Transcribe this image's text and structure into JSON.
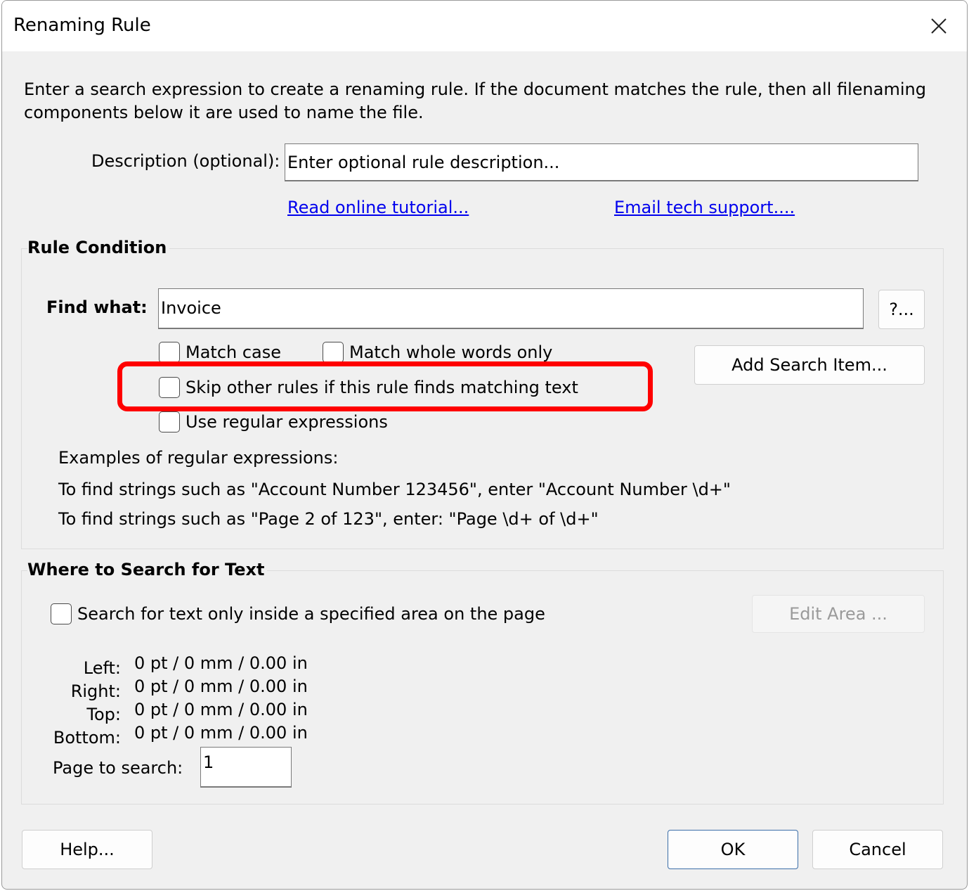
{
  "window": {
    "title": "Renaming Rule"
  },
  "intro_text": "Enter a search expression to create a renaming rule. If the document matches the rule, then all filenaming components below it are used to name the file.",
  "description": {
    "label": "Description (optional):",
    "value": "Enter optional rule description..."
  },
  "links": {
    "tutorial": "Read online tutorial...",
    "support": "Email tech support...."
  },
  "rule_condition": {
    "title": "Rule Condition",
    "find_label": "Find what:",
    "find_value": "Invoice",
    "help_button": "?...",
    "add_search_button": "Add Search Item...",
    "match_case": "Match case",
    "match_whole_words": "Match whole words only",
    "skip_other_rules": "Skip other rules if this rule finds matching text",
    "use_regex": "Use regular expressions",
    "examples_title": "Examples of regular expressions:",
    "example_1": "To find strings such as \"Account Number 123456\", enter \"Account Number \\d+\"",
    "example_2": "To find strings such as \"Page 2 of 123\", enter: \"Page \\d+ of \\d+\""
  },
  "where_to_search": {
    "title": "Where to Search for Text",
    "area_checkbox": "Search for text only inside a specified area on the page",
    "edit_area_button": "Edit Area ...",
    "left_label": "Left:",
    "left_value": "0 pt / 0 mm / 0.00 in",
    "right_label": "Right:",
    "right_value": "0 pt / 0 mm / 0.00 in",
    "top_label": "Top:",
    "top_value": "0 pt / 0 mm / 0.00 in",
    "bottom_label": "Bottom:",
    "bottom_value": "0 pt / 0 mm / 0.00 in",
    "page_label": "Page to search:",
    "page_value": "1"
  },
  "buttons": {
    "help": "Help...",
    "ok": "OK",
    "cancel": "Cancel"
  },
  "colors": {
    "link": "#0000ee",
    "highlight": "#ff0000",
    "dialog_bg": "#f0f0f0"
  }
}
